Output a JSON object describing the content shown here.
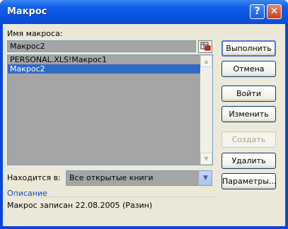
{
  "window": {
    "title": "Макрос"
  },
  "titlebar": {
    "help_glyph": "?",
    "close_glyph": "✕"
  },
  "macro_name": {
    "label": "Имя макроса:",
    "value": "Макрос2"
  },
  "macro_list": {
    "items": [
      {
        "label": "PERSONAL.XLS!Макрос1",
        "selected": false
      },
      {
        "label": "Макрос2",
        "selected": true
      }
    ]
  },
  "location": {
    "label": "Находится в:",
    "value": "Все открытые книги"
  },
  "description": {
    "label": "Описание",
    "text": "Макрос записан 22.08.2005 (Разин)"
  },
  "buttons": {
    "run": "Выполнить",
    "cancel": "Отмена",
    "step_into": "Войти",
    "edit": "Изменить",
    "create": "Создать",
    "delete": "Удалить",
    "options": "Параметры..."
  },
  "colors": {
    "title_bar": "#0a54e0",
    "selection": "#3169c6",
    "field_bg": "#a5a5a5",
    "dialog_bg": "#ece9d8"
  }
}
